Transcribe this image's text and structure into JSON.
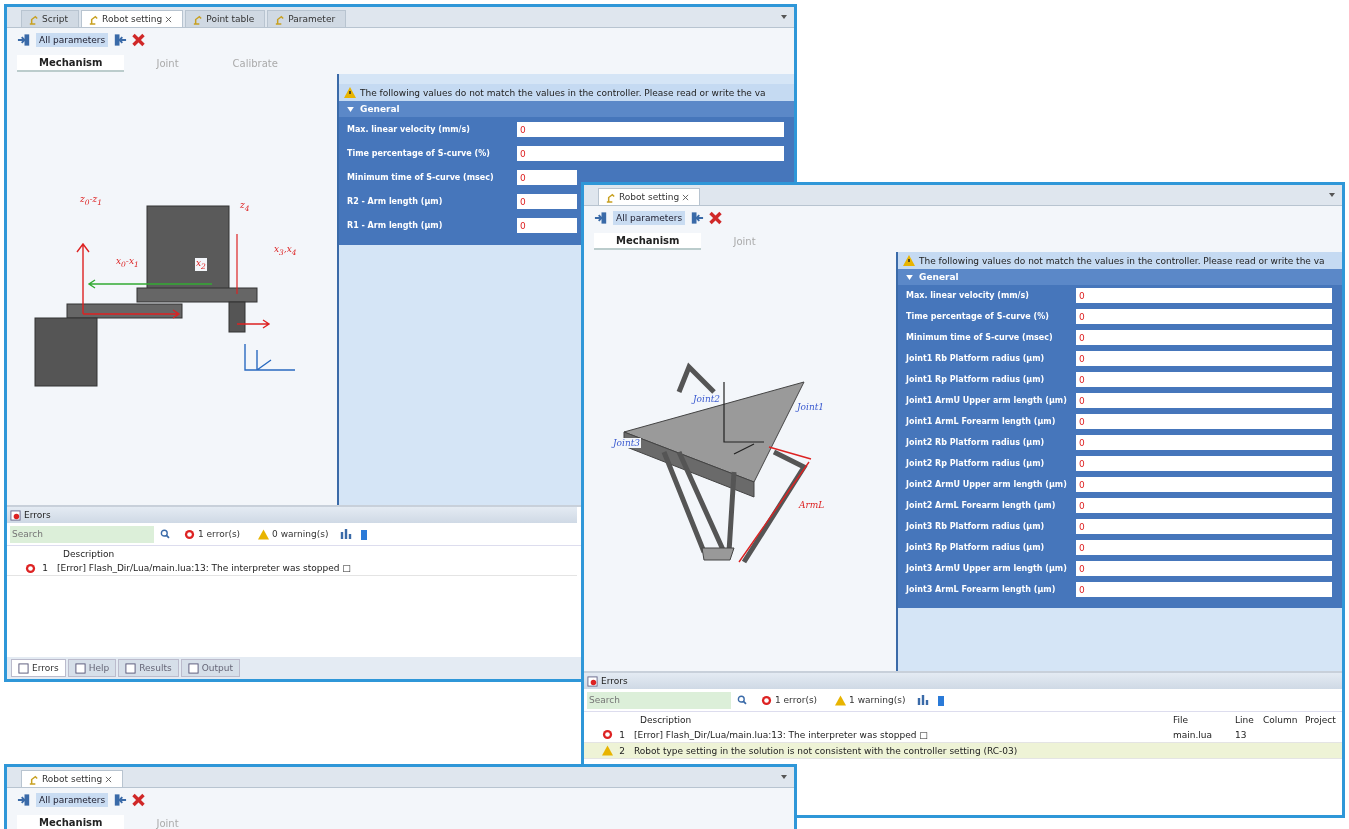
{
  "windows": [
    {
      "doc_tabs": [
        {
          "label": "Script",
          "selected": false,
          "closable": false
        },
        {
          "label": "Robot setting",
          "selected": true,
          "closable": true
        },
        {
          "label": "Point table",
          "selected": false,
          "closable": false
        },
        {
          "label": "Parameter",
          "selected": false,
          "closable": false
        }
      ],
      "toolbar": {
        "label": "All parameters"
      },
      "sub_tabs": [
        {
          "label": "Mechanism",
          "selected": true
        },
        {
          "label": "Joint",
          "selected": false
        },
        {
          "label": "Calibrate",
          "selected": false
        }
      ],
      "diagram": {
        "kind": "scara",
        "labels": [
          "z$_{0}$-z$_{1}$",
          "x$_{0}$-x$_{1}$",
          "x$_{2}$",
          "z$_{4}$",
          "x$_{3}$,x$_{4}$"
        ]
      },
      "panel": {
        "warning": "The following values do not match the values in the controller. Please read or write the va",
        "group": "General",
        "fields": [
          {
            "label": "Max. linear velocity (mm/s)",
            "value": "0"
          },
          {
            "label": "Time percentage of S-curve (%)",
            "value": "0"
          },
          {
            "label": "Minimum time of S-curve (msec)",
            "value": "0"
          },
          {
            "label": "R2 - Arm length (μm)",
            "value": "0"
          },
          {
            "label": "R1 - Arm length (μm)",
            "value": "0"
          }
        ]
      },
      "errors": {
        "title": "Errors",
        "search_placeholder": "Search",
        "error_count": "1 error(s)",
        "warning_count": "0 warning(s)",
        "columns": [
          "Description"
        ],
        "rows": [
          {
            "kind": "error",
            "index": "1",
            "cells": [
              "[Error] Flash_Dir/Lua/main.lua:13: The interpreter was stopped □"
            ],
            "selected": false
          }
        ]
      },
      "bottom_tabs": [
        {
          "label": "Errors",
          "selected": true
        },
        {
          "label": "Help",
          "selected": false
        },
        {
          "label": "Results",
          "selected": false
        },
        {
          "label": "Output",
          "selected": false
        }
      ]
    },
    {
      "doc_tabs": [
        {
          "label": "Robot setting",
          "selected": true,
          "closable": true
        }
      ],
      "toolbar": {
        "label": "All parameters"
      },
      "sub_tabs": [
        {
          "label": "Mechanism",
          "selected": true
        },
        {
          "label": "Joint",
          "selected": false
        }
      ],
      "diagram": {
        "kind": "delta",
        "labels": [
          "Joint2",
          "Joint1",
          "Joint3",
          "ArmL"
        ]
      },
      "panel": {
        "warning": "The following values do not match the values in the controller. Please read or write the va",
        "group": "General",
        "fields": [
          {
            "label": "Max. linear velocity (mm/s)",
            "value": "0"
          },
          {
            "label": "Time percentage of S-curve (%)",
            "value": "0"
          },
          {
            "label": "Minimum time of S-curve (msec)",
            "value": "0"
          },
          {
            "label": "Joint1 Rb Platform radius (μm)",
            "value": "0"
          },
          {
            "label": "Joint1 Rp Platform radius (μm)",
            "value": "0"
          },
          {
            "label": "Joint1 ArmU Upper arm length (μm)",
            "value": "0"
          },
          {
            "label": "Joint1 ArmL Forearm length (μm)",
            "value": "0"
          },
          {
            "label": "Joint2 Rb Platform radius (μm)",
            "value": "0"
          },
          {
            "label": "Joint2 Rp Platform radius (μm)",
            "value": "0"
          },
          {
            "label": "Joint2 ArmU Upper arm length (μm)",
            "value": "0"
          },
          {
            "label": "Joint2 ArmL Forearm length (μm)",
            "value": "0"
          },
          {
            "label": "Joint3 Rb Platform radius (μm)",
            "value": "0"
          },
          {
            "label": "Joint3 Rp Platform radius (μm)",
            "value": "0"
          },
          {
            "label": "Joint3 ArmU Upper arm length (μm)",
            "value": "0"
          },
          {
            "label": "Joint3 ArmL Forearm length (μm)",
            "value": "0"
          }
        ]
      },
      "errors": {
        "title": "Errors",
        "search_placeholder": "Search",
        "error_count": "1 error(s)",
        "warning_count": "1 warning(s)",
        "columns": [
          "Description",
          "File",
          "Line",
          "Column",
          "Project"
        ],
        "rows": [
          {
            "kind": "error",
            "index": "1",
            "cells": [
              "[Error] Flash_Dir/Lua/main.lua:13: The interpreter was stopped □",
              "main.lua",
              "13"
            ],
            "selected": false
          },
          {
            "kind": "warning",
            "index": "2",
            "cells": [
              "Robot type setting in the solution is not consistent with the controller setting (RC-03)"
            ],
            "selected": true
          }
        ]
      }
    },
    {
      "doc_tabs": [
        {
          "label": "Robot setting",
          "selected": true,
          "closable": true
        }
      ],
      "toolbar": {
        "label": "All parameters"
      },
      "sub_tabs": [
        {
          "label": "Mechanism",
          "selected": true
        },
        {
          "label": "Joint",
          "selected": false
        }
      ]
    }
  ]
}
